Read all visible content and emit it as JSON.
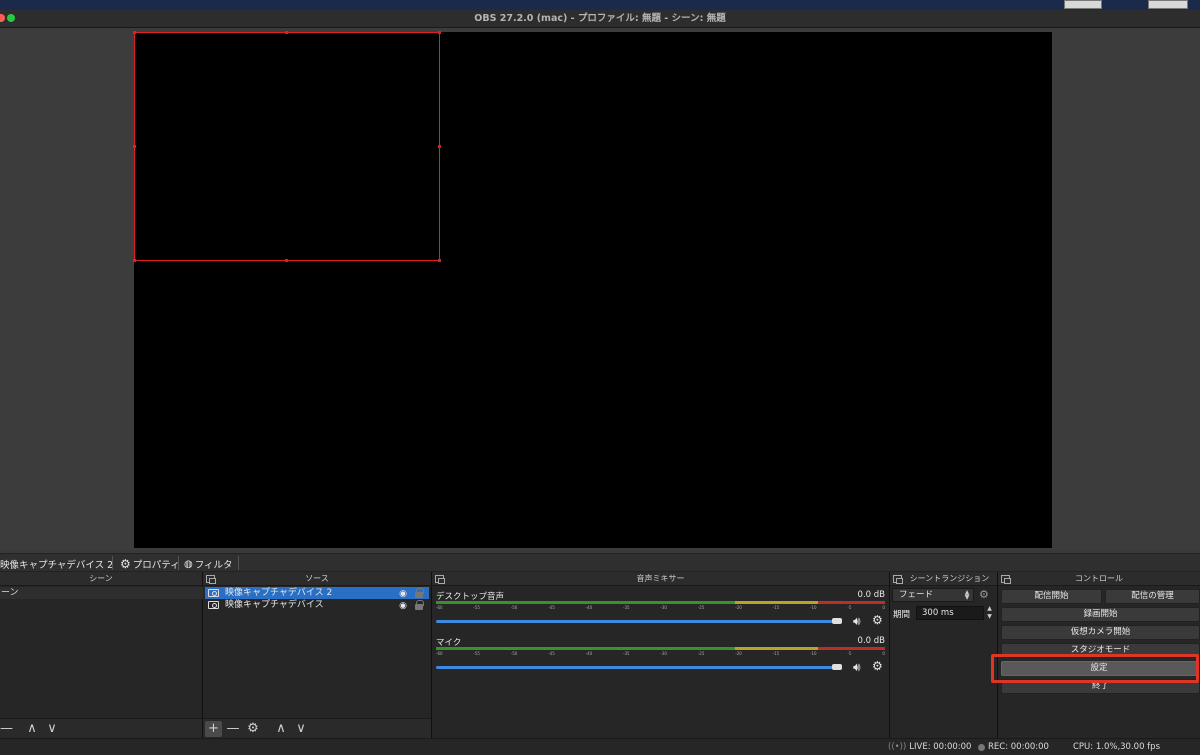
{
  "window": {
    "title": "OBS 27.2.0 (mac) - プロファイル: 無題 - シーン: 無題",
    "traffic_colors": {
      "red": "#ff5f57",
      "green": "#28c840"
    }
  },
  "source_toolbar": {
    "source_name": "映像キャプチャデバイス 2",
    "properties_label": "プロパティ",
    "filters_label": "フィルタ"
  },
  "scenes": {
    "title": "シーン",
    "items": [
      "シーン"
    ],
    "remove_label": "—"
  },
  "sources": {
    "title": "ソース",
    "items": [
      {
        "name": "映像キャプチャデバイス 2",
        "selected": true
      },
      {
        "name": "映像キャプチャデバイス",
        "selected": false
      }
    ],
    "add_label": "+",
    "remove_label": "—"
  },
  "mixer": {
    "title": "音声ミキサー",
    "ticks": [
      "-60",
      "-55",
      "-50",
      "-45",
      "-40",
      "-35",
      "-30",
      "-25",
      "-20",
      "-15",
      "-10",
      "-5",
      "0"
    ],
    "channels": [
      {
        "name": "デスクトップ音声",
        "db": "0.0 dB",
        "volume": 1.0
      },
      {
        "name": "マイク",
        "db": "0.0 dB",
        "volume": 1.0
      }
    ]
  },
  "transitions": {
    "title": "シーントランジション",
    "selected": "フェード",
    "duration_label": "期間",
    "duration_value": "300 ms"
  },
  "controls": {
    "title": "コントロール",
    "start_streaming": "配信開始",
    "manage_broadcast": "配信の管理",
    "start_recording": "録画開始",
    "start_virtual_cam": "仮想カメラ開始",
    "studio_mode": "スタジオモード",
    "settings": "設定",
    "exit": "終了",
    "highlight_color": "#e03424"
  },
  "status": {
    "live": "LIVE: 00:00:00",
    "rec": "REC: 00:00:00",
    "cpu": "CPU: 1.0%,30.00 fps"
  }
}
